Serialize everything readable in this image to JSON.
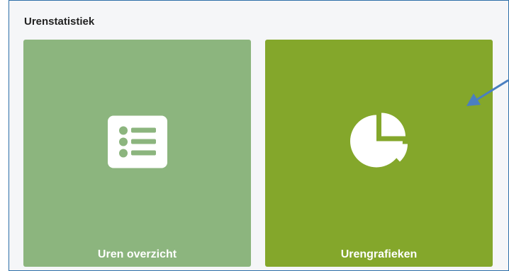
{
  "panel": {
    "title": "Urenstatistiek"
  },
  "tiles": [
    {
      "label": "Uren overzicht",
      "icon": "list-icon",
      "color": "#8cb57e"
    },
    {
      "label": "Urengrafieken",
      "icon": "pie-chart-icon",
      "color": "#84a72b"
    }
  ],
  "colors": {
    "panel_border": "#2d6fa8",
    "panel_background": "#f5f6f8",
    "annotation_arrow": "#4a7fc0"
  }
}
